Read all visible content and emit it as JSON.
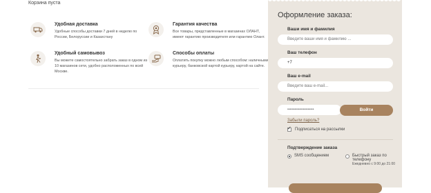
{
  "cart": {
    "empty_text": "Корзина пуста"
  },
  "features": [
    {
      "title": "Удобная доставка",
      "text": "Удобные способы доставки 7 дней в неделю по России, Белоруссии и Казахстану",
      "icon": "delivery-truck-icon"
    },
    {
      "title": "Гарантия качества",
      "text": "Все товары, представленные в магазинах ОЛАНТ, имеют гарантию производителя или гарантию Олант.",
      "icon": "quality-medal-icon"
    },
    {
      "title": "Удобный самовывоз",
      "text": "Вы можете самостоятельно забрать заказ в одном из 10 магазинов сети, удобно расположенных по всей Москве.",
      "icon": "pickup-person-icon"
    },
    {
      "title": "Способы оплаты",
      "text": "Оплатить покупку можно любым способом: наличными курьеру, банковской картой курьеру, картой на сайте.",
      "icon": "payment-hand-icon"
    }
  ],
  "form": {
    "title": "Оформление заказа:",
    "name_label": "Ваши имя и фамилия",
    "name_placeholder": "Введите ваши имя и фамилию ...",
    "phone_label": "Ваш телефон",
    "phone_value": "+7",
    "email_label": "Ваш e-mail",
    "email_placeholder": "Введите ваш e-mail...",
    "password_label": "Пароль",
    "password_value": "••••••••••••••••••••••",
    "login_button": "Войти",
    "forgot_link": "Забыли пароль?",
    "subscribe_label": "Подписаться на рассылки",
    "confirm_title": "Подтверждение заказа",
    "confirm_sms": "SMS сообщением",
    "confirm_call": "Быстрый заказ по телефону",
    "confirm_call_hours": "Ежедневно с 9:00 до 21:00"
  }
}
